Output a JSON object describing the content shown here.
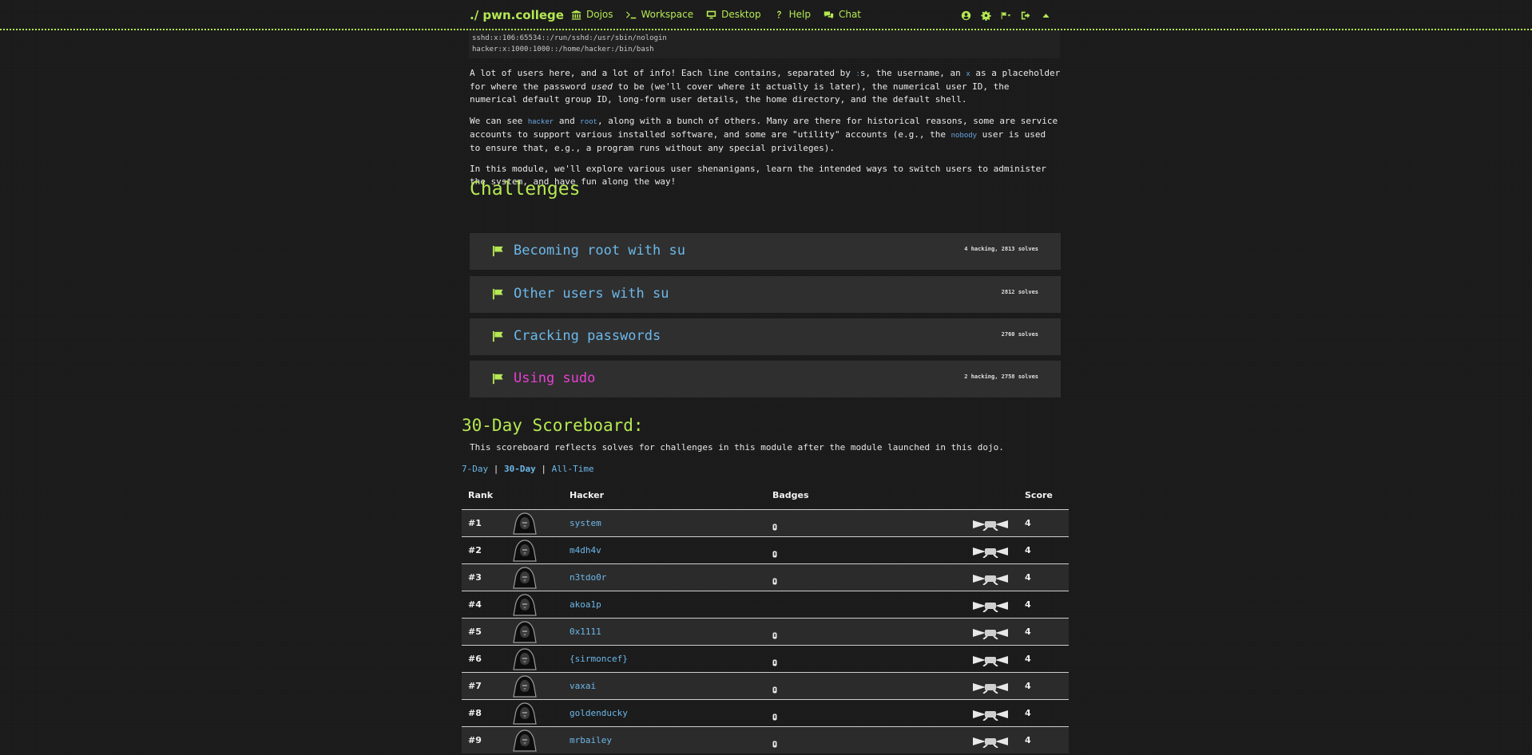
{
  "nav": {
    "brand": "./ pwn.college",
    "links": [
      {
        "label": "Dojos",
        "icon": "building-columns-icon"
      },
      {
        "label": "Workspace",
        "icon": "terminal-icon"
      },
      {
        "label": "Desktop",
        "icon": "desktop-icon"
      },
      {
        "label": "Help",
        "icon": "question-icon"
      },
      {
        "label": "Chat",
        "icon": "comments-icon"
      }
    ],
    "right_icons": [
      "user-circle-icon",
      "settings-icon",
      "flag-dropdown-icon",
      "logout-icon",
      "caret-up-icon"
    ]
  },
  "code": {
    "line1": "sshd:x:106:65534::/run/sshd:/usr/sbin/nologin",
    "line2": "hacker:x:1000:1000::/home/hacker:/bin/bash"
  },
  "text": {
    "p1a": "A lot of users here, and a lot of info! Each line contains, separated by ",
    "p1_colon": ":",
    "p1b": "s, the username, an ",
    "p1_x": "x",
    "p1c": " as a placeholder for where the password ",
    "p1_used": "used",
    "p1d": " to be (we'll cover where it actually is later), the numerical user ID, the numerical default group ID, long-form user details, the home directory, and the default shell.",
    "p2a": "We can see ",
    "p2_hacker": "hacker",
    "p2b": " and ",
    "p2_root": "root",
    "p2c": ", along with a bunch of others. Many are there for historical reasons, some are service accounts to support various installed software, and some are \"utility\" accounts (e.g., the ",
    "p2_nobody": "nobody",
    "p2d": " user is used to ensure that, e.g., a program runs without any special privileges).",
    "p3": "In this module, we'll explore various user shenanigans, learn the intended ways to switch users to administer the system, and have fun along the way!"
  },
  "challenges": {
    "heading": "Challenges",
    "items": [
      {
        "title": "Becoming root with su",
        "meta": "4 hacking, 2813 solves",
        "solved": true
      },
      {
        "title": "Other users with su",
        "meta": "2812 solves",
        "solved": true
      },
      {
        "title": "Cracking passwords",
        "meta": "2760 solves",
        "solved": true
      },
      {
        "title": "Using sudo",
        "meta": "2 hacking, 2758 solves",
        "solved": false
      }
    ]
  },
  "scoreboard": {
    "heading": "30-Day Scoreboard:",
    "description": "This scoreboard reflects solves for challenges in this module after the module launched in this dojo.",
    "tabs": [
      "7-Day",
      "30-Day",
      "All-Time"
    ],
    "separator": "|",
    "active_tab": "30-Day",
    "columns": {
      "rank": "Rank",
      "hacker": "Hacker",
      "badges": "Badges",
      "score": "Score"
    },
    "rows": [
      {
        "rank": "#1",
        "hacker": "system",
        "badge": true,
        "score": "4"
      },
      {
        "rank": "#2",
        "hacker": "m4dh4v",
        "badge": true,
        "score": "4"
      },
      {
        "rank": "#3",
        "hacker": "n3tdo0r",
        "badge": true,
        "score": "4"
      },
      {
        "rank": "#4",
        "hacker": "akoa1p",
        "badge": false,
        "score": "4"
      },
      {
        "rank": "#5",
        "hacker": "0x1111",
        "badge": true,
        "score": "4"
      },
      {
        "rank": "#6",
        "hacker": "{sirmoncef}",
        "badge": true,
        "score": "4"
      },
      {
        "rank": "#7",
        "hacker": "vaxai",
        "badge": true,
        "score": "4"
      },
      {
        "rank": "#8",
        "hacker": "goldenducky",
        "badge": true,
        "score": "4"
      },
      {
        "rank": "#9",
        "hacker": "mrbailey",
        "badge": true,
        "score": "4"
      }
    ]
  },
  "colors": {
    "accent": "#b5e853",
    "link": "#6cb8ea",
    "unsolved": "#e83fd3"
  }
}
